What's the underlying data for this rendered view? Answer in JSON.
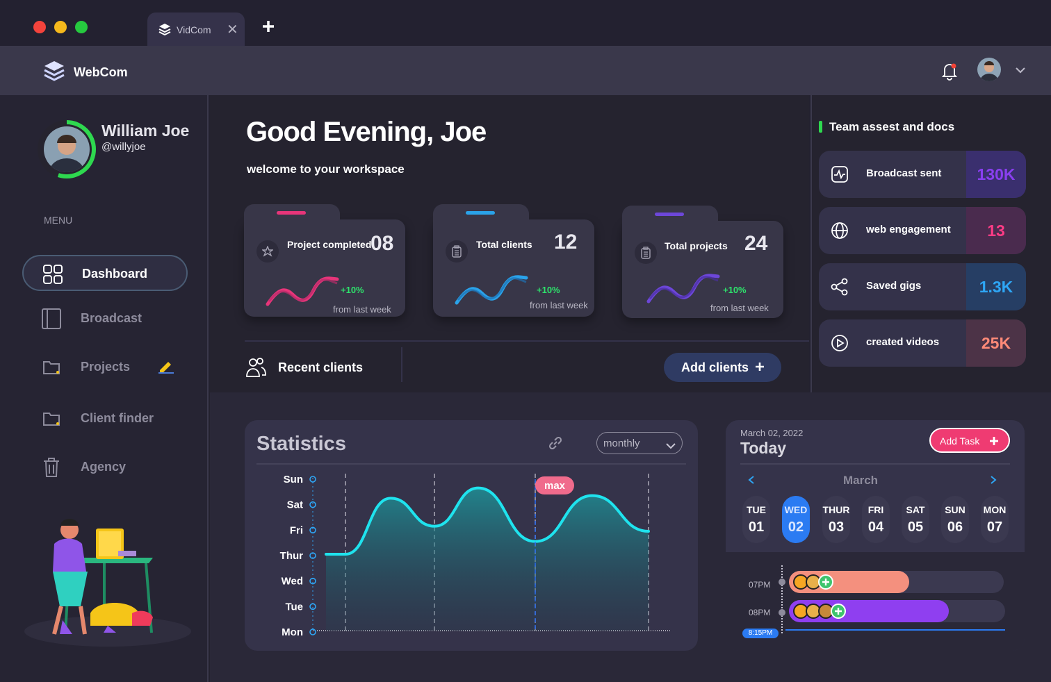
{
  "browser": {
    "tab_title": "VidCom"
  },
  "app": {
    "brand": "WebCom"
  },
  "profile": {
    "name": "William Joe",
    "handle": "@willyjoe"
  },
  "menu": {
    "heading": "MENU",
    "items": [
      {
        "label": "Dashboard",
        "icon": "grid-icon",
        "active": true
      },
      {
        "label": "Broadcast",
        "icon": "book-icon"
      },
      {
        "label": "Projects",
        "icon": "folder-icon"
      },
      {
        "label": "Client finder",
        "icon": "folder-icon"
      },
      {
        "label": "Agency",
        "icon": "trash-icon"
      }
    ]
  },
  "greeting": {
    "title": "Good Evening, Joe",
    "subtitle": "welcome to your workspace"
  },
  "cards": [
    {
      "label": "Project completed",
      "value": "08",
      "change": "+10%",
      "note": "from last week",
      "color": "#e8357a",
      "icon": "star-icon"
    },
    {
      "label": "Total clients",
      "value": "12",
      "change": "+10%",
      "note": "from last week",
      "color": "#2aa3ea",
      "icon": "clipboard-icon"
    },
    {
      "label": "Total projects",
      "value": "24",
      "change": "+10%",
      "note": "from last week",
      "color": "#6d47d9",
      "icon": "clipboard-icon"
    }
  ],
  "recent_clients": {
    "label": "Recent clients",
    "add_button": "Add clients"
  },
  "team": {
    "title": "Team assest and docs",
    "stats": [
      {
        "label": "Broadcast sent",
        "value": "130K",
        "color": "#8a3ff0",
        "bg": "#3a2f6e",
        "icon": "pulse-icon"
      },
      {
        "label": "web engagement",
        "value": "13",
        "color": "#ff3c86",
        "bg": "#4a2b4e",
        "icon": "globe-icon"
      },
      {
        "label": "Saved gigs",
        "value": "1.3K",
        "color": "#2ea6f5",
        "bg": "#263e64",
        "icon": "share-icon"
      },
      {
        "label": "created videos",
        "value": "25K",
        "color": "#ff8a78",
        "bg": "#4c3347",
        "icon": "play-icon"
      }
    ]
  },
  "statistics": {
    "title": "Statistics",
    "period": "monthly",
    "max_label": "max"
  },
  "chart_data": {
    "type": "area",
    "y_categories": [
      "Sun",
      "Sat",
      "Fri",
      "Thur",
      "Wed",
      "Tue",
      "Mon"
    ],
    "series": [
      {
        "values": [
          3.0,
          3.0,
          5.2,
          4.1,
          5.6,
          3.5,
          5.3,
          3.9
        ]
      }
    ],
    "ylim": [
      0,
      6
    ],
    "annotation": "max",
    "grid": "vertical dashed"
  },
  "schedule": {
    "date": "March 02, 2022",
    "title": "Today",
    "add_task": "Add Task",
    "month": "March",
    "days": [
      {
        "name": "TUE",
        "num": "01"
      },
      {
        "name": "WED",
        "num": "02",
        "active": true
      },
      {
        "name": "THUR",
        "num": "03"
      },
      {
        "name": "FRI",
        "num": "04"
      },
      {
        "name": "SAT",
        "num": "05"
      },
      {
        "name": "SUN",
        "num": "06"
      },
      {
        "name": "MON",
        "num": "07"
      }
    ],
    "times": [
      "07PM",
      "08PM"
    ],
    "current_time": "8:15PM",
    "bars": [
      {
        "fill": 0.56,
        "color": "#f4907e"
      },
      {
        "fill": 0.74,
        "color": "#8f3ff0"
      }
    ]
  }
}
